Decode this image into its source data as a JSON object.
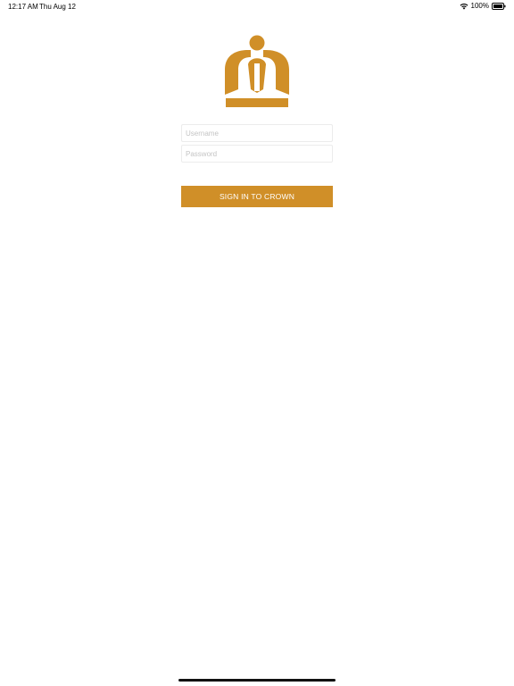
{
  "status_bar": {
    "time": "12:17 AM",
    "date": "Thu Aug 12",
    "battery": "100%",
    "wifi_icon": "wifi-icon",
    "battery_icon": "battery-icon"
  },
  "brand": {
    "logo_icon": "crown-icon",
    "accent_color": "#d08f28"
  },
  "login_form": {
    "username": {
      "value": "",
      "placeholder": "Username"
    },
    "password": {
      "value": "",
      "placeholder": "Password"
    },
    "submit_label": "SIGN IN TO CROWN"
  }
}
